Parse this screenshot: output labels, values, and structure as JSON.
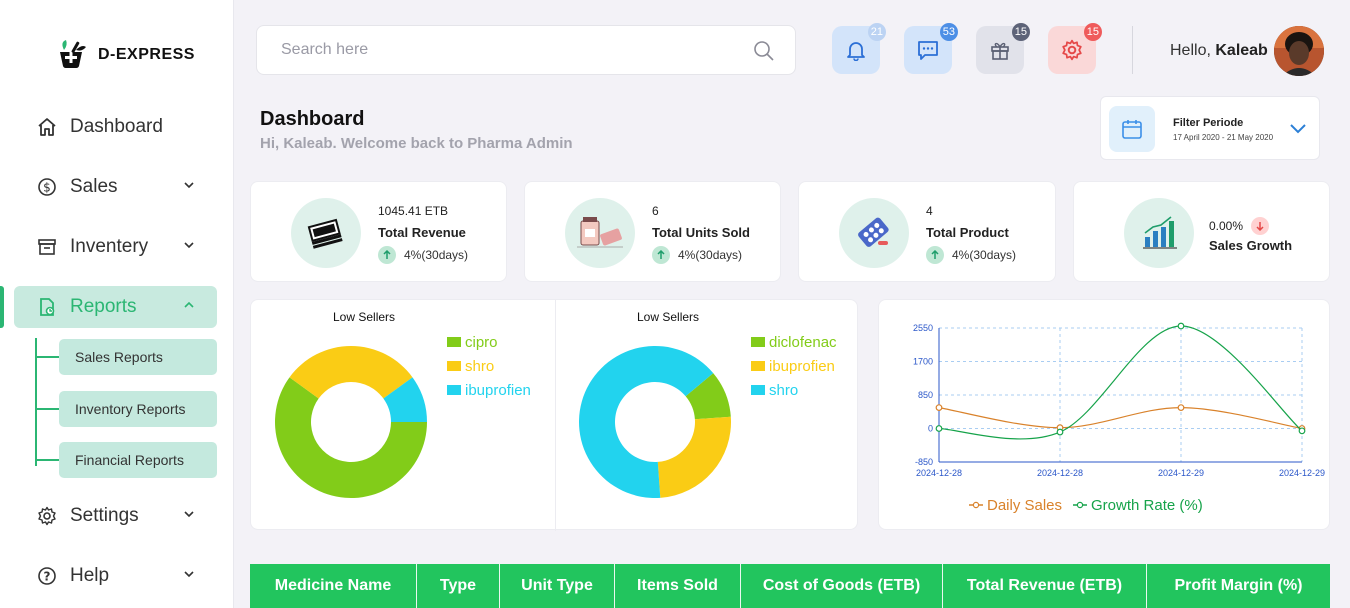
{
  "app": {
    "name": "D-EXPRESS"
  },
  "sidebar": {
    "items": [
      {
        "label": "Dashboard",
        "icon": "home-icon"
      },
      {
        "label": "Sales",
        "icon": "dollar-icon"
      },
      {
        "label": "Inventery",
        "icon": "archive-icon"
      },
      {
        "label": "Reports",
        "icon": "report-icon"
      },
      {
        "label": "Settings",
        "icon": "gear-icon"
      },
      {
        "label": "Help",
        "icon": "help-icon"
      }
    ],
    "reports_sub": [
      {
        "label": "Sales Reports"
      },
      {
        "label": "Inventory Reports"
      },
      {
        "label": "Financial Reports"
      }
    ]
  },
  "header": {
    "search_placeholder": "Search here",
    "notifications": {
      "count": "21",
      "icon": "bell-icon"
    },
    "messages": {
      "count": "53",
      "icon": "chat-icon"
    },
    "gifts": {
      "count": "15",
      "icon": "gift-icon"
    },
    "settings": {
      "count": "15",
      "icon": "gear-icon"
    },
    "greeting": "Hello,",
    "user_name": "Kaleab"
  },
  "page": {
    "title": "Dashboard",
    "subtitle": "Hi, Kaleab. Welcome back to Pharma Admin",
    "filter": {
      "title": "Filter Periode",
      "range": "17 April 2020 - 21 May 2020"
    }
  },
  "stats": [
    {
      "value": "1045.41 ETB",
      "label": "Total Revenue",
      "trend": "4%(30days)"
    },
    {
      "value": "6",
      "label": "Total Units Sold",
      "trend": "4%(30days)"
    },
    {
      "value": "4",
      "label": "Total Product",
      "trend": "4%(30days)"
    },
    {
      "value": "0.00%",
      "label": "Sales Growth"
    }
  ],
  "colors": {
    "green": "#82cc19",
    "yellow": "#facc15",
    "cyan": "#22d3ee",
    "accent": "#2bb673",
    "table_header": "#22c55e",
    "daily_sales": "#d9822b",
    "growth_rate": "#16a34a"
  },
  "chart_data": [
    {
      "type": "pie",
      "title": "Low Sellers",
      "donut": true,
      "labels": [
        "cipro",
        "shro",
        "ibuprofien"
      ],
      "values": [
        60,
        30,
        10
      ],
      "colors": [
        "#82cc19",
        "#facc15",
        "#22d3ee"
      ],
      "legend": "right"
    },
    {
      "type": "pie",
      "title": "Low Sellers",
      "donut": true,
      "labels": [
        "diclofenac",
        "ibuprofien",
        "shro"
      ],
      "values": [
        10,
        25,
        65
      ],
      "colors": [
        "#82cc19",
        "#facc15",
        "#22d3ee"
      ],
      "legend": "right"
    },
    {
      "type": "line",
      "x": [
        "2024-12-28",
        "2024-12-28",
        "2024-12-29",
        "2024-12-29"
      ],
      "series": [
        {
          "name": "Daily Sales",
          "values": [
            530,
            20,
            530,
            0
          ],
          "color": "#d9822b"
        },
        {
          "name": "Growth Rate (%)",
          "values": [
            0,
            -90,
            2600,
            -60
          ],
          "color": "#16a34a"
        }
      ],
      "yticks": [
        "2550",
        "1700",
        "850",
        "0",
        "-850"
      ],
      "ylim": [
        -850,
        2550
      ],
      "grid": true,
      "legend": "bottom"
    }
  ],
  "table": {
    "columns": [
      "Medicine Name",
      "Type",
      "Unit Type",
      "Items Sold",
      "Cost of Goods (ETB)",
      "Total Revenue (ETB)",
      "Profit Margin (%)"
    ]
  }
}
